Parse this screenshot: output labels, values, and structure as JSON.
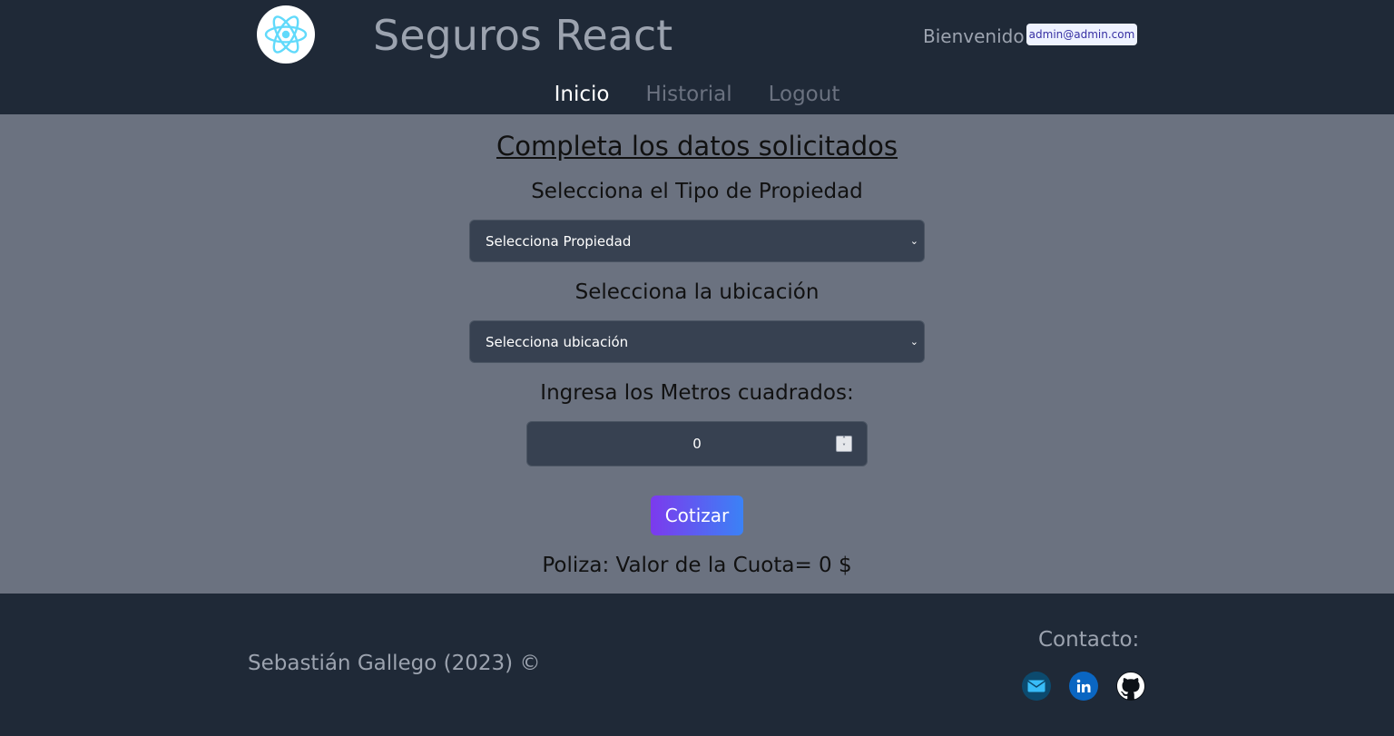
{
  "header": {
    "title": "Seguros React",
    "welcome_label": "Bienvenido:",
    "user_email": "admin@admin.com",
    "logo_icon": "react-logo-icon"
  },
  "nav": {
    "items": [
      {
        "label": "Inicio",
        "active": true
      },
      {
        "label": "Historial",
        "active": false
      },
      {
        "label": "Logout",
        "active": false
      }
    ]
  },
  "form": {
    "title": "Completa los datos solicitados",
    "property_label": "Selecciona el Tipo de Propiedad",
    "property_selected": "Selecciona Propiedad",
    "location_label": "Selecciona la ubicación",
    "location_selected": "Selecciona ubicación",
    "meters_label": "Ingresa los Metros cuadrados:",
    "meters_value": "0",
    "submit_label": "Cotizar",
    "result_text": "Poliza: Valor de la Cuota= 0 $"
  },
  "footer": {
    "copyright": "Sebastián Gallego (2023) ©",
    "contact_title": "Contacto:",
    "social_icons": [
      "mail-icon",
      "linkedin-icon",
      "github-icon"
    ]
  },
  "colors": {
    "header_bg": "#1f2937",
    "main_bg": "#6b7280",
    "input_bg": "#374151",
    "button_gradient_start": "#7c3aed",
    "button_gradient_end": "#3b82f6"
  }
}
